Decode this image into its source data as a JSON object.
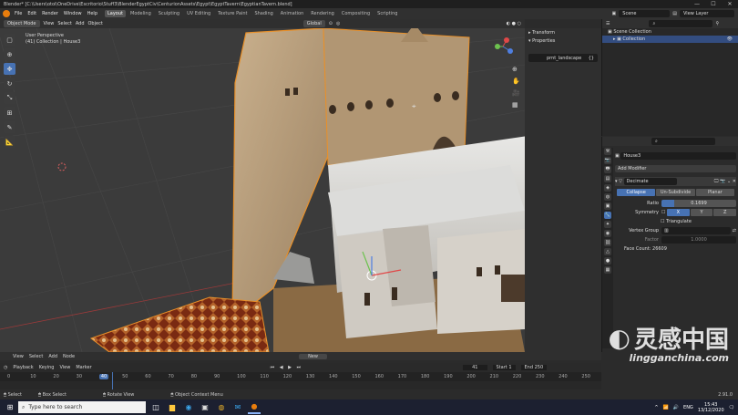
{
  "window": {
    "title": "Blender* [C:\\Users\\otoi\\OneDrive\\Escritorio\\Stuff3\\BlenderEgyptCiv\\CenturionAssets\\Egypt\\EgyptTavern\\EgyptianTavern.blend]",
    "controls": [
      "—",
      "☐",
      "✕"
    ]
  },
  "topbar": {
    "menus": [
      "File",
      "Edit",
      "Render",
      "Window",
      "Help"
    ],
    "workspaces": [
      "Layout",
      "Modeling",
      "Sculpting",
      "UV Editing",
      "Texture Paint",
      "Shading",
      "Animation",
      "Rendering",
      "Compositing",
      "Scripting"
    ],
    "active_workspace": "Layout",
    "scene": "Scene",
    "view_layer": "View Layer"
  },
  "viewport_header": {
    "mode": "Object Mode",
    "menus": [
      "View",
      "Select",
      "Add",
      "Object"
    ],
    "orientation": "Global"
  },
  "viewport": {
    "perspective": "User Perspective",
    "collection": "(41) Collection | House3"
  },
  "npanel": {
    "section1": "Transform",
    "section2": "Properties",
    "prop_field": "prnt_landscape",
    "prop_value": "{}"
  },
  "outliner": {
    "items": [
      "Scene Collection",
      "Collection"
    ]
  },
  "properties": {
    "object_name": "House3",
    "add_modifier": "Add Modifier",
    "modifier": "Decimate",
    "modes": [
      "Collapse",
      "Un-Subdivide",
      "Planar"
    ],
    "active_mode": "Collapse",
    "ratio_label": "Ratio",
    "ratio_value": "0.1699",
    "symmetry_label": "Symmetry",
    "axes": [
      "X",
      "Y",
      "Z"
    ],
    "triangulate": "Triangulate",
    "vertex_group": "Vertex Group",
    "factor_label": "Factor",
    "factor_value": "1.0000",
    "face_count": "Face Count: 26609"
  },
  "timeline": {
    "menus": [
      "View",
      "Select",
      "Add",
      "Node"
    ],
    "new_button": "New",
    "playback": "Playback",
    "keying": "Keying",
    "view": "View",
    "marker": "Marker",
    "current_frame": "41",
    "start_label": "Start",
    "start": "1",
    "end_label": "End",
    "end": "250",
    "ticks": [
      "0",
      "10",
      "20",
      "30",
      "40",
      "50",
      "60",
      "70",
      "80",
      "90",
      "100",
      "110",
      "120",
      "130",
      "140",
      "150",
      "160",
      "170",
      "180",
      "190",
      "200",
      "210",
      "220",
      "230",
      "240",
      "250"
    ]
  },
  "statusbar": {
    "select": "Select",
    "box_select": "Box Select",
    "rotate_view": "Rotate View",
    "context_menu": "Object Context Menu",
    "version": "2.91.0"
  },
  "taskbar": {
    "search_placeholder": "Type here to search",
    "lang": "ENG",
    "time": "15:43",
    "date": "13/12/2020"
  },
  "watermark": {
    "main": "灵感中国",
    "url": "lingganchina.com"
  }
}
